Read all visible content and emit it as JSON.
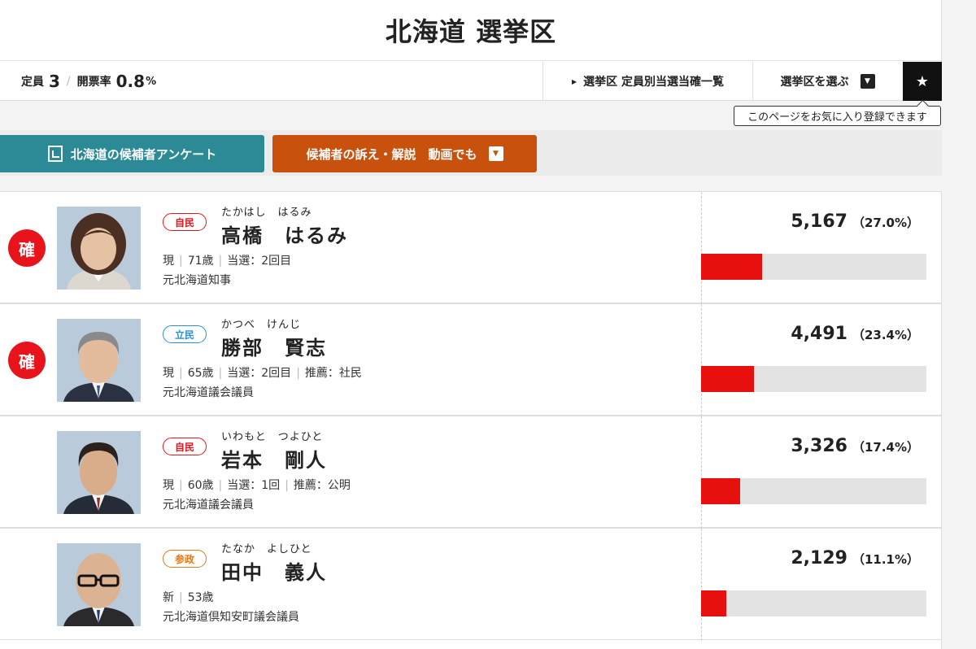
{
  "title": "北海道 選挙区",
  "stats": {
    "seats_label": "定員",
    "seats_value": "3",
    "rate_label": "開票率",
    "rate_value": "0.8",
    "rate_unit": "%"
  },
  "nav": {
    "list_link": "選挙区 定員別当選当確一覧",
    "select_district": "選挙区を選ぶ"
  },
  "favorite_tooltip": "このページをお気に入り登録できます",
  "buttons": {
    "survey": "北海道の候補者アンケート",
    "video": "候補者の訴え・解説　動画でも"
  },
  "win_badge": "確",
  "colors": {
    "win": "#e8141c",
    "bar": "#e80f0f",
    "survey_btn": "#2b8a96",
    "video_btn": "#c9510e",
    "ldp": "#e8141c",
    "cdp": "#2a8fd6",
    "sansei": "#e07b1a"
  },
  "candidates": [
    {
      "elected": true,
      "party": "自民",
      "party_color": "#e8141c",
      "kana": "たかはし　はるみ",
      "name": "高橋　はるみ",
      "status": "現",
      "age": "71歳",
      "term": "当選：2回目",
      "endorse": "",
      "career": "元北海道知事",
      "votes": "5,167",
      "pct": "（27.0%）",
      "share": 27.0
    },
    {
      "elected": true,
      "party": "立民",
      "party_color": "#2a8fd6",
      "kana": "かつべ　けんじ",
      "name": "勝部　賢志",
      "status": "現",
      "age": "65歳",
      "term": "当選：2回目",
      "endorse": "推薦：社民",
      "career": "元北海道議会議員",
      "votes": "4,491",
      "pct": "（23.4%）",
      "share": 23.4
    },
    {
      "elected": false,
      "party": "自民",
      "party_color": "#e8141c",
      "kana": "いわもと　つよひと",
      "name": "岩本　剛人",
      "status": "現",
      "age": "60歳",
      "term": "当選：1回",
      "endorse": "推薦：公明",
      "career": "元北海道議会議員",
      "votes": "3,326",
      "pct": "（17.4%）",
      "share": 17.4
    },
    {
      "elected": false,
      "party": "参政",
      "party_color": "#e07b1a",
      "kana": "たなか　よしひと",
      "name": "田中　義人",
      "status": "新",
      "age": "53歳",
      "term": "",
      "endorse": "",
      "career": "元北海道倶知安町議会議員",
      "votes": "2,129",
      "pct": "（11.1%）",
      "share": 11.1
    }
  ]
}
